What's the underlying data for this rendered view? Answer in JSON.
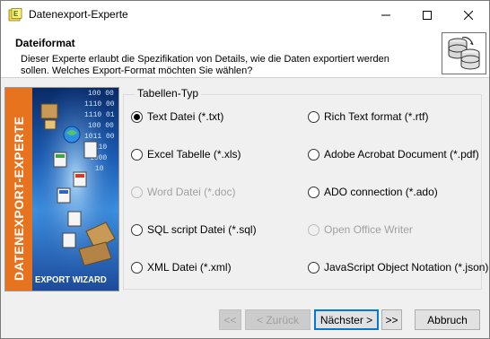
{
  "window": {
    "title": "Datenexport-Experte"
  },
  "header": {
    "title": "Dateiformat",
    "description": "Dieser Experte erlaubt die Spezifikation von Details, wie die Daten exportiert werden sollen. Welches Export-Format möchten Sie wählen?"
  },
  "banner": {
    "vertical_text": "DATENEXPORT-EXPERTE",
    "caption": "EXPORT WIZARD",
    "binary_lines": [
      "100 00",
      "1110 00",
      "1110 01",
      "100 00",
      "1011 00",
      "1110",
      "1000",
      "10"
    ]
  },
  "group": {
    "legend": "Tabellen-Typ",
    "options": [
      {
        "label": "Text Datei (*.txt)",
        "checked": true,
        "enabled": true
      },
      {
        "label": "Rich Text format (*.rtf)",
        "checked": false,
        "enabled": true
      },
      {
        "label": "Excel Tabelle (*.xls)",
        "checked": false,
        "enabled": true
      },
      {
        "label": "Adobe Acrobat Document (*.pdf)",
        "checked": false,
        "enabled": true
      },
      {
        "label": "Word Datei (*.doc)",
        "checked": false,
        "enabled": false
      },
      {
        "label": "ADO connection (*.ado)",
        "checked": false,
        "enabled": true
      },
      {
        "label": "SQL script Datei (*.sql)",
        "checked": false,
        "enabled": true
      },
      {
        "label": "Open Office Writer",
        "checked": false,
        "enabled": false
      },
      {
        "label": "XML Datei (*.xml)",
        "checked": false,
        "enabled": true
      },
      {
        "label": "JavaScript Object Notation (*.json)",
        "checked": false,
        "enabled": true
      }
    ]
  },
  "footer": {
    "first_label": "<<",
    "back_label": "< Zurück",
    "next_label": "Nächster >",
    "last_label": ">>",
    "cancel_label": "Abbruch"
  },
  "colors": {
    "accent": "#0078d7",
    "banner_orange": "#e8731e"
  }
}
